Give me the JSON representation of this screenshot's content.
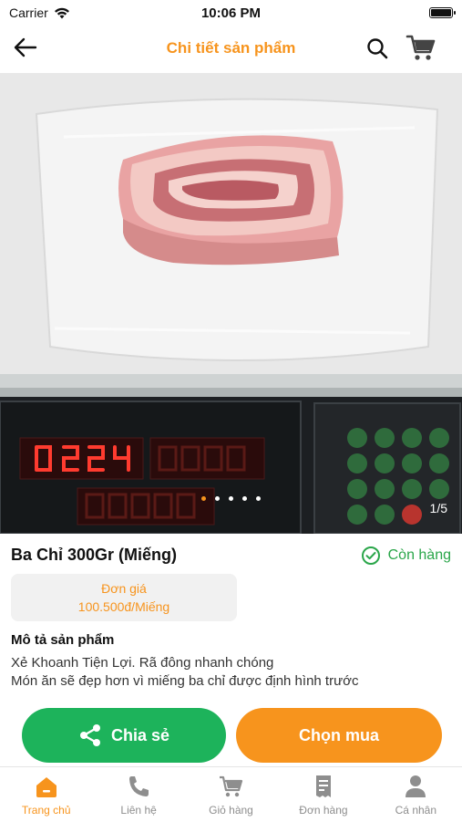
{
  "status_bar": {
    "carrier": "Carrier",
    "time": "10:06 PM"
  },
  "header": {
    "title": "Chi tiết sản phẩm"
  },
  "gallery": {
    "counter": "1/5",
    "total_images": 5,
    "active_index": 1
  },
  "product": {
    "name": "Ba Chỉ 300Gr (Miếng)",
    "stock_status": "Còn hàng",
    "price_label": "Đơn giá",
    "price_value": "100.500đ/Miếng",
    "description_title": "Mô tả sản phẩm",
    "description_lines": [
      "Xẻ Khoanh Tiện Lợi. Rã đông nhanh chóng",
      "Món ăn sẽ đẹp hơn vì miếng ba chỉ được định hình trước"
    ]
  },
  "actions": {
    "share_label": "Chia sẻ",
    "buy_label": "Chọn mua"
  },
  "tabbar": {
    "items": [
      {
        "label": "Trang chủ",
        "icon": "home-icon",
        "active": true
      },
      {
        "label": "Liên hệ",
        "icon": "phone-icon",
        "active": false
      },
      {
        "label": "Giỏ hàng",
        "icon": "cart-icon",
        "active": false
      },
      {
        "label": "Đơn hàng",
        "icon": "receipt-icon",
        "active": false
      },
      {
        "label": "Cá nhân",
        "icon": "person-icon",
        "active": false
      }
    ]
  },
  "colors": {
    "accent": "#f7941d",
    "success": "#1db35b",
    "text": "#111111"
  }
}
